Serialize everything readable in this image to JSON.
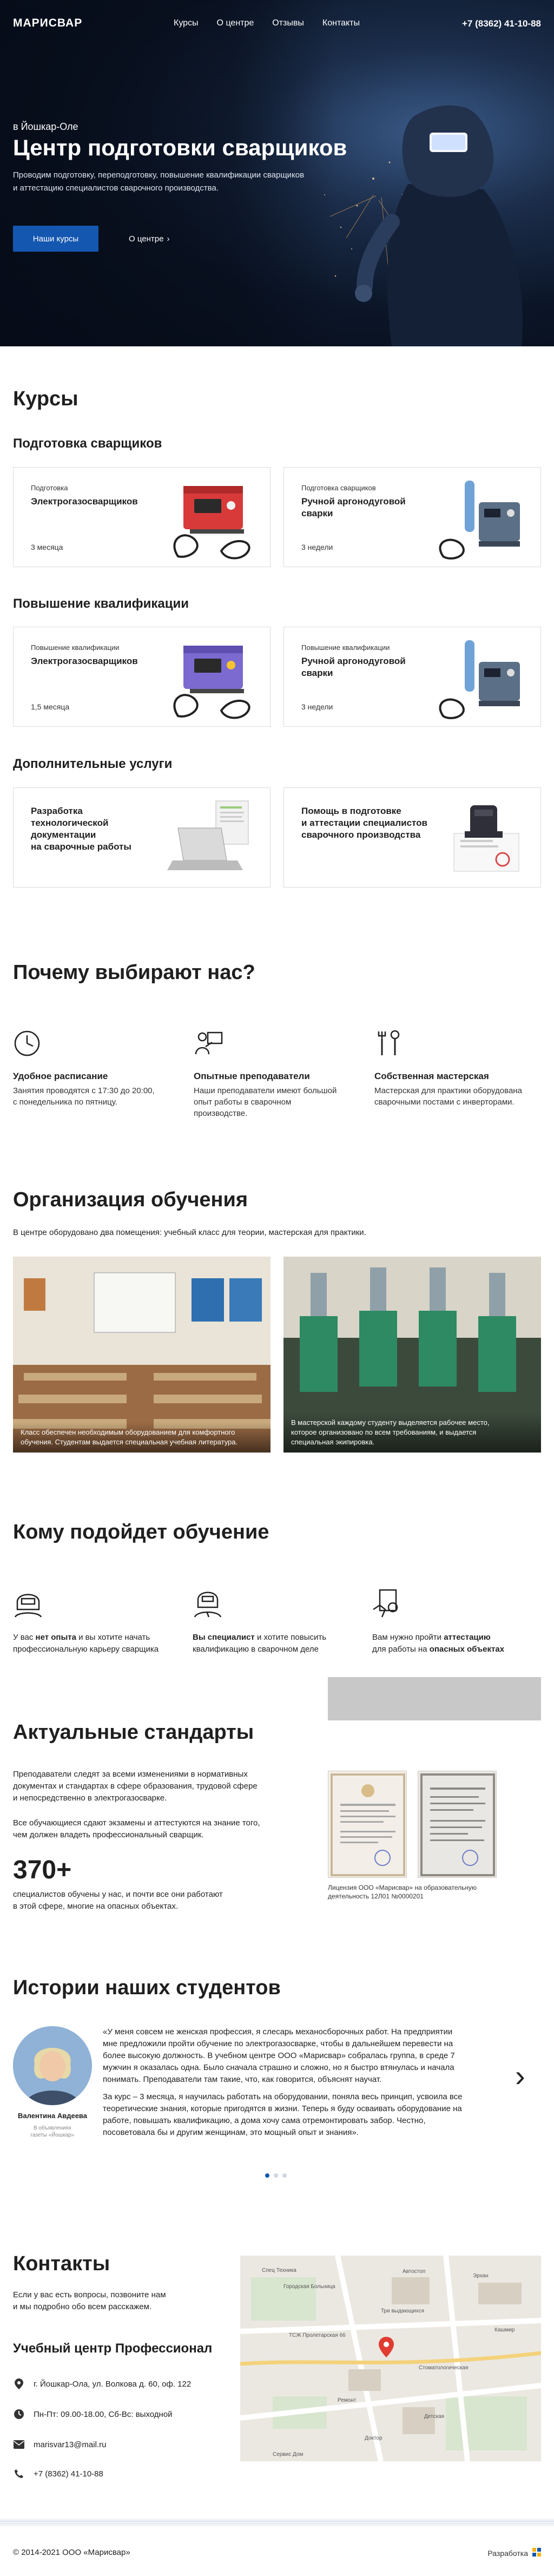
{
  "header": {
    "logo": "МАРИСВАР",
    "nav": [
      "Курсы",
      "О центре",
      "Отзывы",
      "Контакты"
    ],
    "phone": "+7 (8362) 41-10-88"
  },
  "hero": {
    "city": "в Йошкар-Оле",
    "title": "Центр подготовки сварщиков",
    "desc_line1": "Проводим подготовку, переподготовку, повышение квалификации сварщиков",
    "desc_line2": "и аттестацию специалистов сварочного производства.",
    "primary_button": "Наши курсы",
    "secondary_button": "О центре",
    "secondary_arrow": "›"
  },
  "courses": {
    "title": "Курсы",
    "training": {
      "title": "Подготовка сварщиков",
      "cards": [
        {
          "tag": "Подготовка",
          "name": "Электрогазосварщиков",
          "duration": "3 месяца",
          "image": "welding-machine-red-icon"
        },
        {
          "tag": "Подготовка сварщиков",
          "name": "Ручной аргонодуговой сварки",
          "duration": "3 недели",
          "image": "welding-machine-blue-icon"
        }
      ]
    },
    "advanced": {
      "title": "Повышение квалификации",
      "cards": [
        {
          "tag": "Повышение квалификации",
          "name": "Электрогазосварщиков",
          "duration": "1,5 месяца",
          "image": "welding-machine-purple-icon"
        },
        {
          "tag": "Повышение квалификации",
          "name": "Ручной аргонодуговой сварки",
          "duration": "3 недели",
          "image": "welding-machine-blue-icon"
        }
      ]
    },
    "extra": {
      "title": "Дополнительные услуги",
      "cards": [
        {
          "name_l1": "Разработка",
          "name_l2": "технологической документации",
          "name_l3": "на сварочные работы",
          "image": "laptop-documents-icon"
        },
        {
          "name_l1": "Помощь в подготовке",
          "name_l2": "и аттестации специалистов",
          "name_l3": "сварочного производства",
          "image": "certificate-stamp-icon"
        }
      ]
    }
  },
  "why": {
    "title": "Почему выбирают нас?",
    "items": [
      {
        "icon": "clock-icon",
        "title": "Удобное расписание",
        "l1": "Занятия проводятся с 17:30 до 20:00,",
        "l2": "с понедельника по пятницу.",
        "l3": ""
      },
      {
        "icon": "teacher-icon",
        "title": "Опытные преподаватели",
        "l1": "Наши преподаватели имеют большой",
        "l2": "опыт работы в сварочном",
        "l3": "производстве."
      },
      {
        "icon": "tools-icon",
        "title": "Собственная мастерская",
        "l1": "Мастерская для практики оборудована",
        "l2": "сварочными постами с инверторами.",
        "l3": ""
      }
    ]
  },
  "org": {
    "title": "Организация обучения",
    "desc": "В центре оборудовано два помещения: учебный класс для теории, мастерская для практики.",
    "photos": [
      {
        "cap1": "Класс обеспечен необходимым оборудованием для комфортного",
        "cap2": "обучения. Студентам выдается специальная учебная литература.",
        "cap3": ""
      },
      {
        "cap1": "В мастерской каждому студенту выделяется рабочее место,",
        "cap2": "которое организовано по всем требованиям, и выдается",
        "cap3": "специальная экипировка."
      }
    ]
  },
  "who": {
    "title": "Кому подойдет обучение",
    "items": [
      {
        "icon": "welder-mask-icon",
        "pre": "У вас ",
        "bold": "нет опыта",
        "post1": " и вы хотите начать",
        "post2": "профессиональную карьеру сварщика"
      },
      {
        "icon": "welder-expert-icon",
        "pre": "",
        "bold": "Вы специалист",
        "post1": " и хотите повысить",
        "post2": "квалификацию в сварочном деле"
      },
      {
        "icon": "certificate-hand-icon",
        "pre": "Вам нужно пройти ",
        "bold": "аттестацию",
        "post1": "",
        "post2": "для работы на ",
        "bold2": "опасных объектах"
      }
    ]
  },
  "standards": {
    "title": "Актуальные стандарты",
    "p1_l1": "Преподаватели следят за всеми изменениями в нормативных",
    "p1_l2": "документах и стандартах в сфере образования, трудовой сфере",
    "p1_l3": "и непосредственно в электрогазосварке.",
    "p2_l1": "Все обучающиеся сдают экзамены и аттестуются на знание того,",
    "p2_l2": "чем должен владеть профессиональный сварщик.",
    "number": "370+",
    "num_l1": "специалистов обучены у нас, и почти все они работают",
    "num_l2": "в этой сфере, многие на опасных объектах.",
    "license_l1": "Лицензия ООО «Марисвар» на образовательную",
    "license_l2": "деятельность 12Л01 №0000201"
  },
  "stories": {
    "title": "Истории наших студентов",
    "name": "Валентина Авдеева",
    "sub1": "В объявлениях",
    "sub2": "газеты «Йошкар»",
    "quote": [
      "«У меня совсем не женская профессия, я слесарь механосборочных работ. На предприятии",
      "мне предложили пройти обучение по электрогазосварке, чтобы в дальнейшем перевести на",
      "более высокую должность. В учебном центре ООО «Марисвар» собралась группа, в среде 7",
      "мужчин я оказалась одна. Было сначала страшно и сложно, но я быстро втянулась и начала",
      "понимать. Преподаватели там такие, что, как говорится, объяснят научат.",
      "",
      "За курс – 3 месяца, я научилась работать на оборудовании, поняла весь принцип, усвоила все",
      "теоретические знания, которые пригодятся в жизни. Теперь я буду осваивать оборудование на",
      "работе, повышать квалификацию, а дома хочу сама отремонтировать забор. Честно,",
      "посоветовала бы и другим женщинам, это мощный опыт и знания»."
    ],
    "next": "›"
  },
  "contacts": {
    "title": "Контакты",
    "intro_l1": "Если у вас есть вопросы, позвоните нам",
    "intro_l2": "и мы подробно обо всем расскажем.",
    "org_name": "Учебный центр Профессионал",
    "address": "г. Йошкар-Ола, ул. Волкова д. 60, оф. 122",
    "hours": "Пн-Пт: 09.00-18.00, Сб-Вс: выходной",
    "email": "marisvar13@mail.ru",
    "phone": "+7 (8362) 41-10-88",
    "map": {
      "labels": [
        "Автостоп",
        "Спец Техника",
        "Городская Больница",
        "Сервис Дом",
        "Стоматологическая",
        "Детская",
        "ТСЖ Пролетарская 66",
        "Кашмир",
        "Три выдающихся",
        "Эрхан",
        "Ремонт",
        "Доктор"
      ]
    }
  },
  "footer": {
    "copyright": "© 2014-2021 ООО «Марисвар»",
    "dev": "Разработка"
  },
  "colors": {
    "primary": "#1457b0",
    "hero_dark": "#0b1527"
  }
}
